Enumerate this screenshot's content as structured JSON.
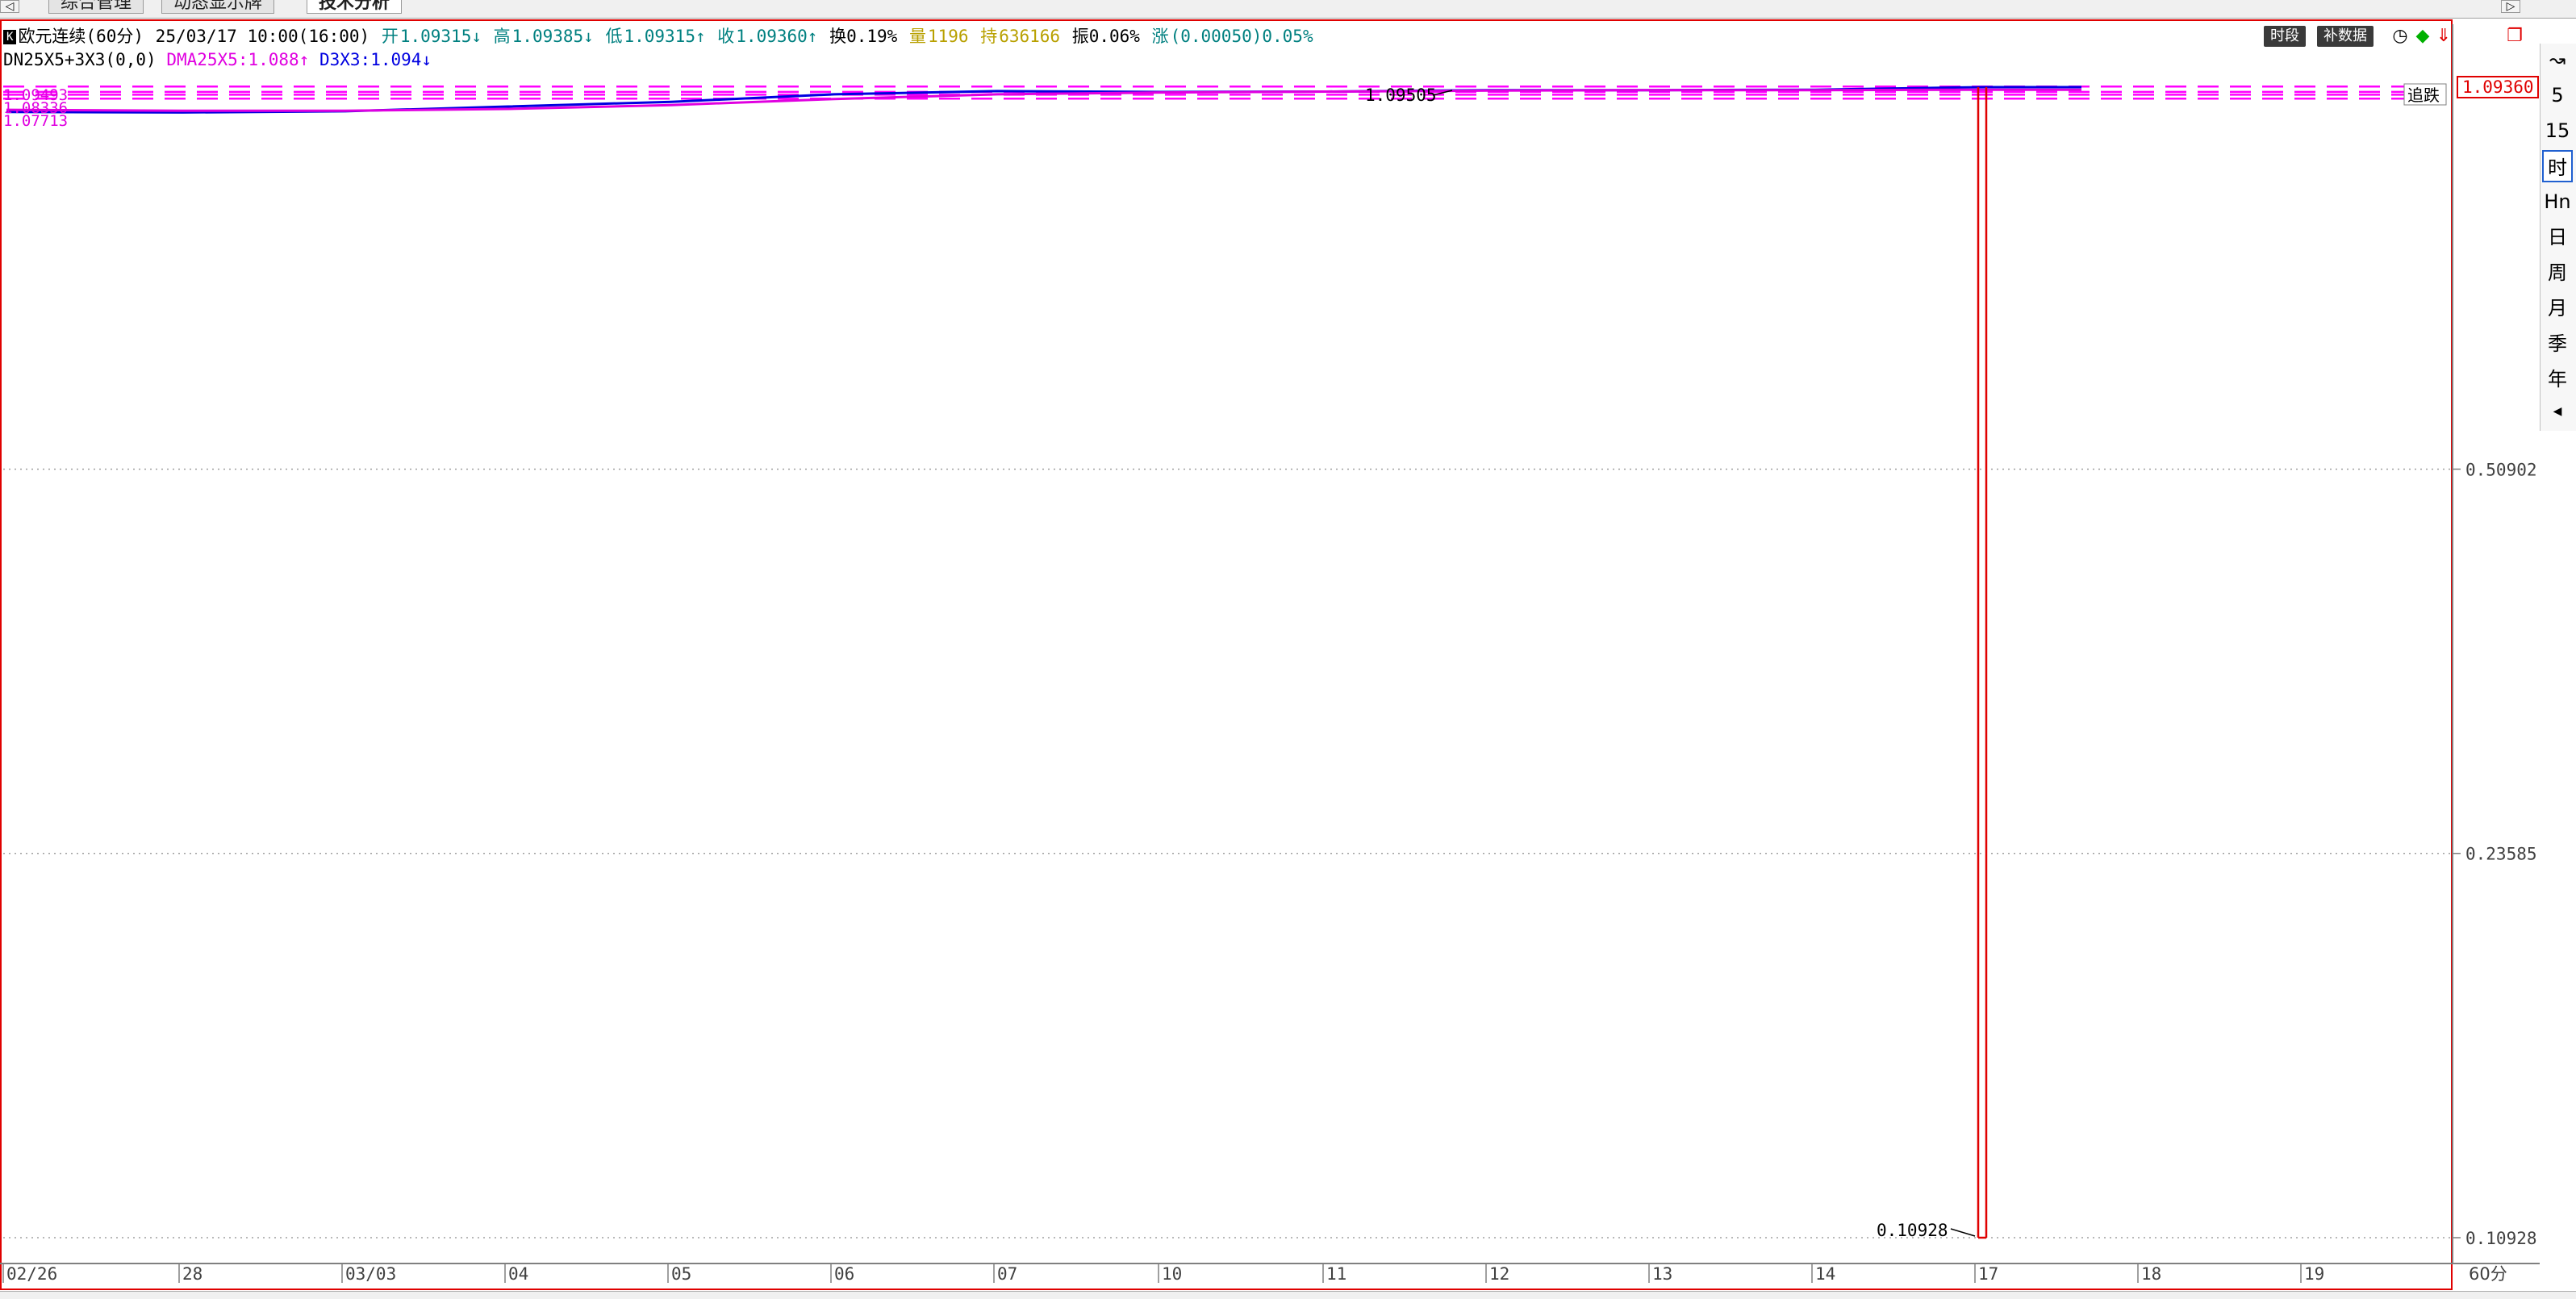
{
  "tabs": [
    {
      "label": "综合管理",
      "active": false
    },
    {
      "label": "动态显示牌",
      "active": false
    },
    {
      "label": "技术分析",
      "active": true
    }
  ],
  "header": {
    "period_badge": "K",
    "instrument": "欧元连续(60分)",
    "datetime": "25/03/17 10:00(16:00)",
    "open_label": "开",
    "open_value": "1.09315↓",
    "high_label": "高",
    "high_value": "1.09385↓",
    "low_label": "低",
    "low_value": "1.09315↑",
    "close_label": "收",
    "close_value": "1.09360↑",
    "turnover": "换0.19%",
    "volume_label": "量",
    "volume_value": "1196",
    "oi_label": "持",
    "oi_value": "636166",
    "amp": "振0.06%",
    "change_label": "涨",
    "change_value": "(0.00050)0.05%"
  },
  "indicator": {
    "name": "DN25X5+3X3(0,0)",
    "dma_label": "DMA25X5:1.088↑",
    "d3x3_label": "D3X3:1.094↓"
  },
  "toolbar": {
    "time_button": "时段",
    "fill_button": "补数据",
    "clock_icon": "clock-icon",
    "diamond_icon": "diamond-icon",
    "down_arrow_icon": "red-down-arrow-icon",
    "restore_icon": "window-restore-icon"
  },
  "colors": {
    "frame": "#e00000",
    "price_line": "#0000e0",
    "ma_line": "#e000e0",
    "dashed_band": "#ff00ff",
    "spike": "#e00000",
    "grid": "#a0a0a0"
  },
  "chart_data": {
    "type": "line",
    "instrument": "欧元连续(60分)",
    "y_ticks": [
      "1.09360",
      "0.50902",
      "0.23585",
      "0.10928"
    ],
    "y_tick_values": [
      1.0936,
      0.50902,
      0.23585,
      0.10928
    ],
    "y_scale": "log",
    "ylim": [
      0.10928,
      1.0936
    ],
    "x_tick_labels": [
      "02/26",
      "28",
      "03/03",
      "04",
      "05",
      "06",
      "07",
      "10",
      "11",
      "12",
      "13",
      "14",
      "17",
      "18",
      "19"
    ],
    "x_unit_label": "60分",
    "annotations": {
      "max_label": "1.09505",
      "min_label": "0.10928",
      "left_label_top": "1.09493",
      "left_label_mid": "1.08336",
      "left_label_bottom": "1.07713",
      "current_price": "1.09360",
      "tag_right": "追跌"
    },
    "series": [
      {
        "name": "收",
        "x": [
          "02/26",
          "28",
          "03/03",
          "04",
          "05",
          "06",
          "07",
          "10",
          "11",
          "12",
          "13",
          "14",
          "17",
          "17b",
          "18"
        ],
        "values": [
          1.0405,
          1.0395,
          1.042,
          1.052,
          1.062,
          1.078,
          1.085,
          1.083,
          1.084,
          1.087,
          1.087,
          1.088,
          1.0932,
          1.0936,
          1.0936
        ]
      },
      {
        "name": "DMA25X5",
        "x": [
          "02/26",
          "28",
          "03/03",
          "04",
          "05",
          "06",
          "07",
          "10",
          "11",
          "12",
          "13",
          "14",
          "17",
          "17b",
          "18"
        ],
        "values": [
          1.045,
          1.043,
          1.043,
          1.047,
          1.055,
          1.068,
          1.078,
          1.082,
          1.084,
          1.086,
          1.087,
          1.087,
          1.088,
          1.088,
          1.088
        ]
      }
    ],
    "spike": {
      "x": "17",
      "low": 0.10928,
      "high": 1.0936
    },
    "dashed_levels": [
      1.09493,
      1.08336,
      1.07713,
      1.06871
    ]
  }
}
